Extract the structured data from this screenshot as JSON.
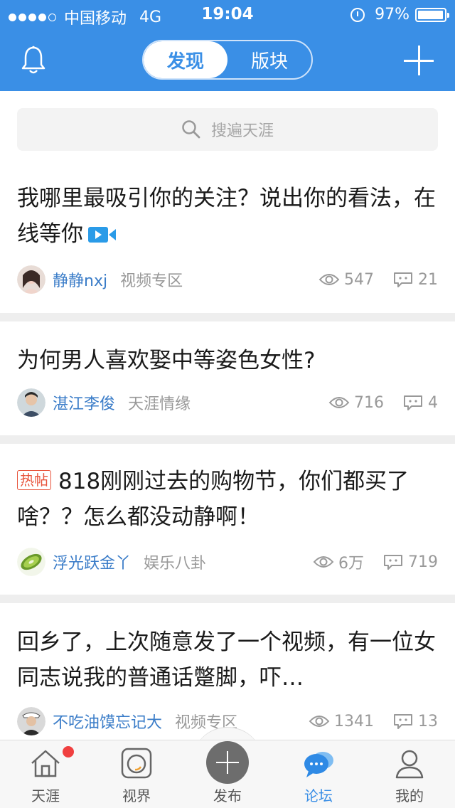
{
  "status_bar": {
    "carrier": "中国移动",
    "network": "4G",
    "time": "19:04",
    "battery": "97%",
    "battery_level": 0.97
  },
  "nav": {
    "tabs": [
      {
        "label": "发现",
        "active": true
      },
      {
        "label": "版块",
        "active": false
      }
    ]
  },
  "search": {
    "placeholder": "搜遍天涯"
  },
  "posts": [
    {
      "title": "我哪里最吸引你的关注？说出你的看法，在线等你",
      "hot_tag": "",
      "has_video": true,
      "author": "静静nxj",
      "board": "视频专区",
      "views": "547",
      "comments": "21"
    },
    {
      "title": "为何男人喜欢娶中等姿色女性?",
      "hot_tag": "",
      "has_video": false,
      "author": "湛江李俊",
      "board": "天涯情缘",
      "views": "716",
      "comments": "4"
    },
    {
      "title": "818刚刚过去的购物节，你们都买了啥？？怎么都没动静啊！",
      "hot_tag": "热帖",
      "has_video": false,
      "author": "浮光跃金丫",
      "board": "娱乐八卦",
      "views": "6万",
      "comments": "719"
    },
    {
      "title": "回乡了，上次随意发了一个视频，有一位女同志说我的普通话蹩脚，吓…",
      "hot_tag": "",
      "has_video": false,
      "author": "不吃油馍忘记大",
      "board": "视频专区",
      "views": "1341",
      "comments": "13"
    }
  ],
  "tab_bar": {
    "items": [
      {
        "label": "天涯",
        "icon": "house-icon",
        "badge": true
      },
      {
        "label": "视界",
        "icon": "camera-icon"
      },
      {
        "label": "发布",
        "icon": "plus-icon"
      },
      {
        "label": "论坛",
        "icon": "chat-bubbles-icon",
        "active": true
      },
      {
        "label": "我的",
        "icon": "person-icon"
      }
    ]
  },
  "colors": {
    "brand": "#3a8fe6",
    "author": "#3a7cc8",
    "hot": "#e8553d",
    "muted": "#999999"
  }
}
